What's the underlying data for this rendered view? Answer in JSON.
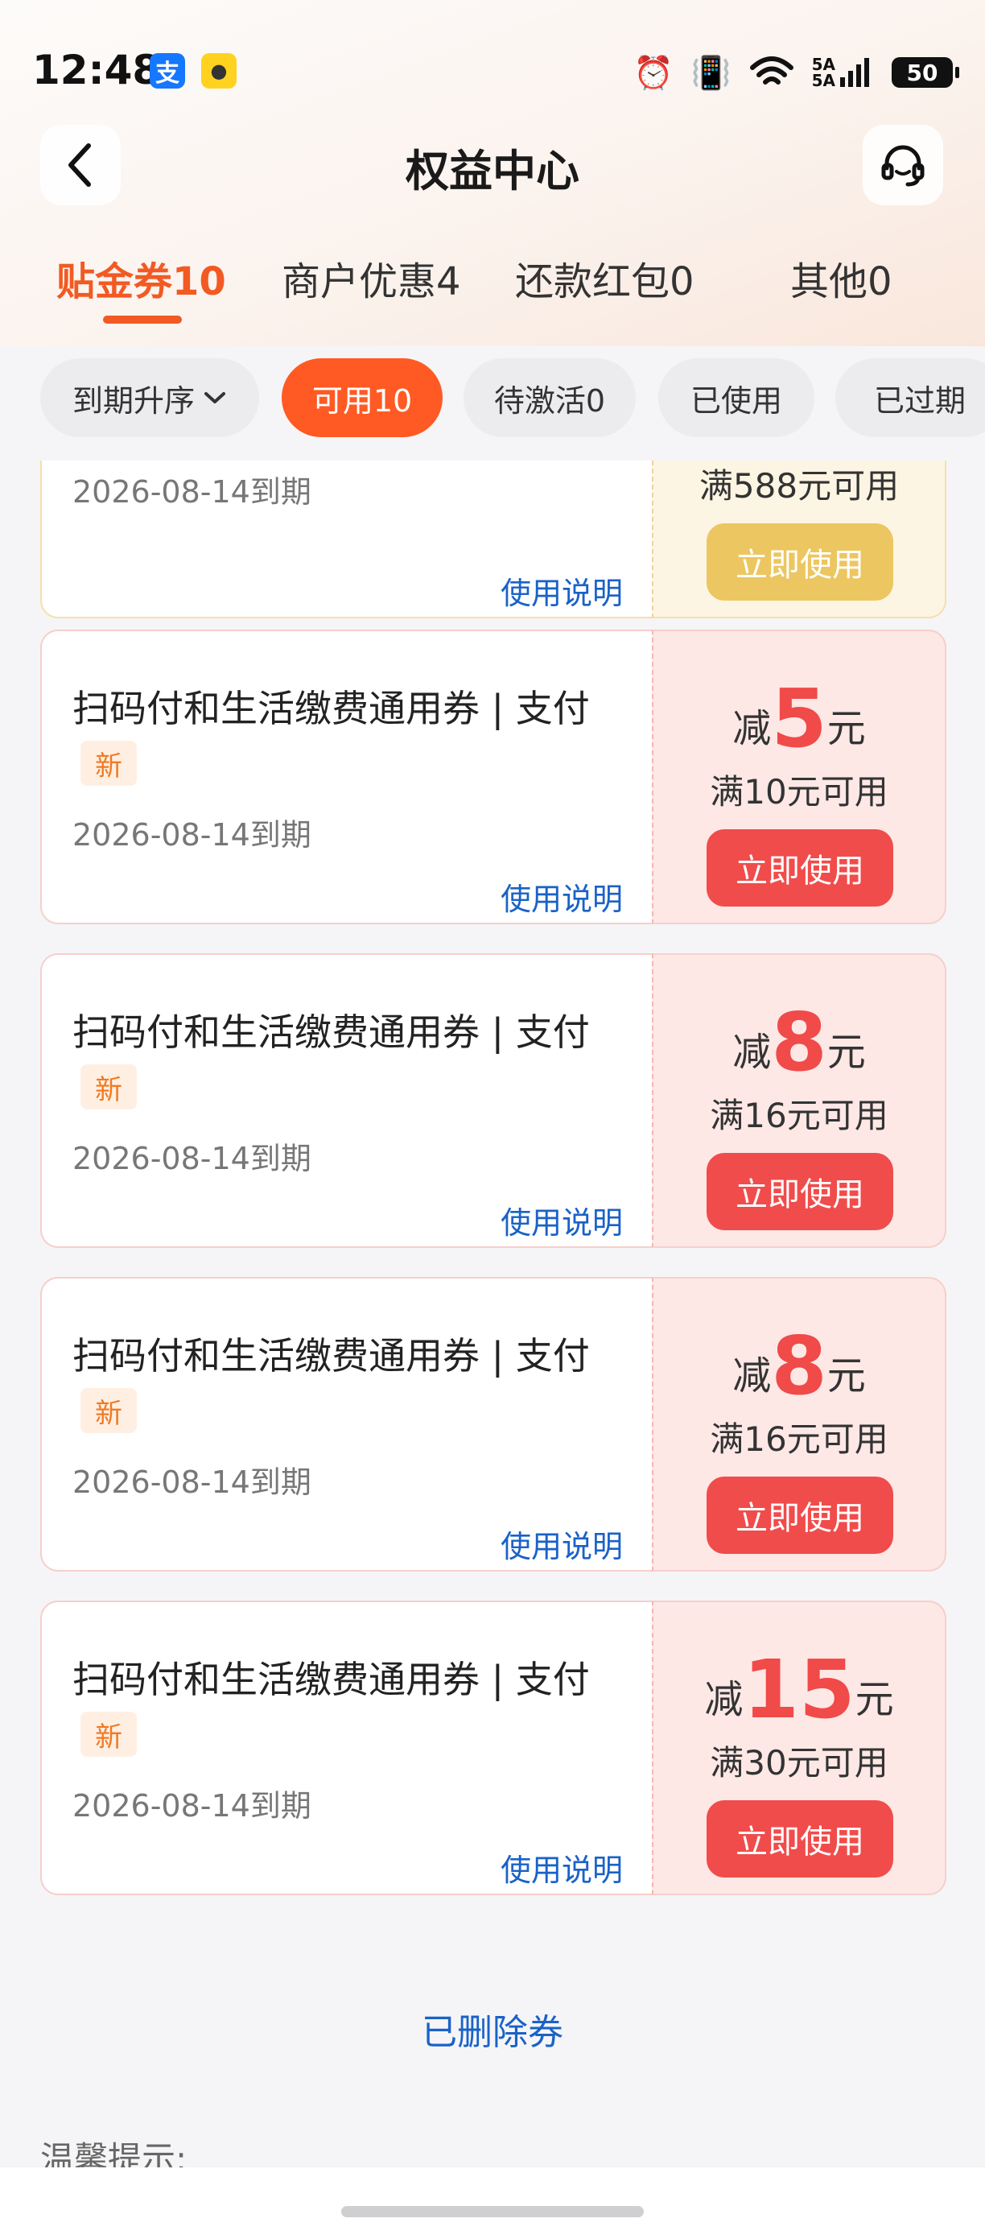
{
  "status_bar": {
    "time": "12:48",
    "battery": "50",
    "signal_text": "5A"
  },
  "header": {
    "title": "权益中心"
  },
  "tabs": [
    {
      "label": "贴金券10",
      "active": true
    },
    {
      "label": "商户优惠4",
      "active": false
    },
    {
      "label": "还款红包0",
      "active": false
    },
    {
      "label": "其他0",
      "active": false
    }
  ],
  "filters": {
    "sort_label": "到期升序",
    "chips": [
      {
        "label": "可用10",
        "active": true
      },
      {
        "label": "待激活0",
        "active": false
      },
      {
        "label": "已使用",
        "active": false
      },
      {
        "label": "已过期",
        "active": false
      }
    ]
  },
  "partial_card": {
    "expiry": "2026-08-14到期",
    "condition": "满588元可用",
    "use_label": "立即使用",
    "usage_link": "使用说明"
  },
  "coupons": [
    {
      "title": "扫码付和生活缴费通用券 | 支付",
      "tag": "新",
      "expiry": "2026-08-14到期",
      "usage_link": "使用说明",
      "prefix": "减",
      "amount": "5",
      "unit": "元",
      "condition": "满10元可用",
      "use_label": "立即使用"
    },
    {
      "title": "扫码付和生活缴费通用券 | 支付",
      "tag": "新",
      "expiry": "2026-08-14到期",
      "usage_link": "使用说明",
      "prefix": "减",
      "amount": "8",
      "unit": "元",
      "condition": "满16元可用",
      "use_label": "立即使用"
    },
    {
      "title": "扫码付和生活缴费通用券 | 支付",
      "tag": "新",
      "expiry": "2026-08-14到期",
      "usage_link": "使用说明",
      "prefix": "减",
      "amount": "8",
      "unit": "元",
      "condition": "满16元可用",
      "use_label": "立即使用"
    },
    {
      "title": "扫码付和生活缴费通用券 | 支付",
      "tag": "新",
      "expiry": "2026-08-14到期",
      "usage_link": "使用说明",
      "prefix": "减",
      "amount": "15",
      "unit": "元",
      "condition": "满30元可用",
      "use_label": "立即使用"
    }
  ],
  "footer": {
    "deleted_link": "已删除券",
    "tips_title": "温馨提示:"
  },
  "colors": {
    "accent": "#f25a23",
    "coupon_red": "#f04c4b",
    "link_blue": "#1a62c7",
    "gold_button": "#ecc660"
  }
}
